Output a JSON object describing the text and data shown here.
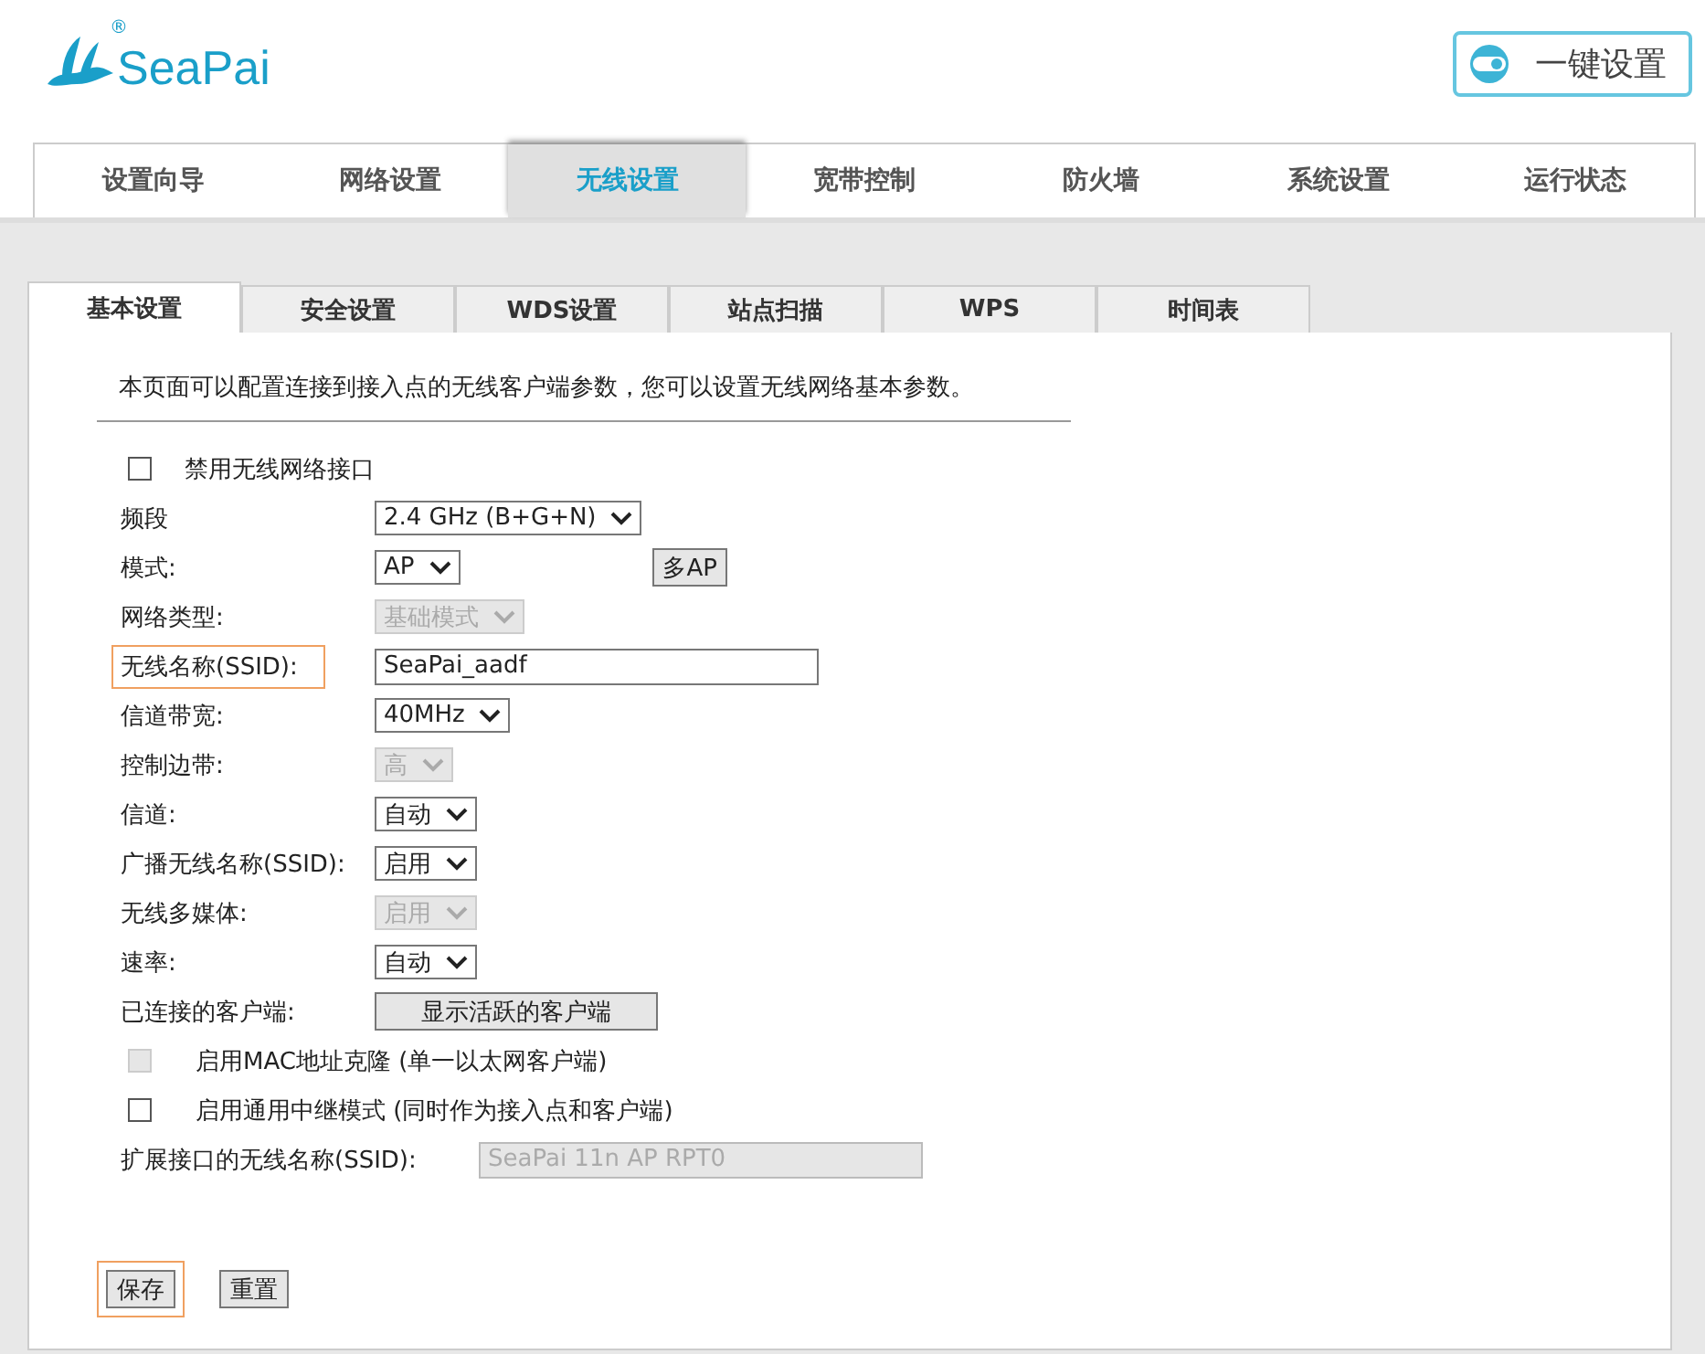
{
  "logo": {
    "name": "SeaPai",
    "mark": "®"
  },
  "quick_setup_button": {
    "label": "一键设置"
  },
  "nav_tabs": [
    {
      "label": "设置向导",
      "selected": false
    },
    {
      "label": "网络设置",
      "selected": false
    },
    {
      "label": "无线设置",
      "selected": true
    },
    {
      "label": "宽带控制",
      "selected": false
    },
    {
      "label": "防火墙",
      "selected": false
    },
    {
      "label": "系统设置",
      "selected": false
    },
    {
      "label": "运行状态",
      "selected": false
    }
  ],
  "sub_tabs": [
    {
      "label": "基本设置",
      "selected": true
    },
    {
      "label": "安全设置",
      "selected": false
    },
    {
      "label": "WDS设置",
      "selected": false
    },
    {
      "label": "站点扫描",
      "selected": false
    },
    {
      "label": "WPS",
      "selected": false
    },
    {
      "label": "时间表",
      "selected": false
    }
  ],
  "description": "本页面可以配置连接到接入点的无线客户端参数，您可以设置无线网络基本参数。",
  "form": [
    {
      "kind": "checkbox",
      "label": "禁用无线网络接口",
      "checked": false,
      "disabled": false
    },
    {
      "kind": "select",
      "label": "频段",
      "value": "2.4 GHz (B+G+N)",
      "disabled": false
    },
    {
      "kind": "select",
      "label": "模式:",
      "value": "AP",
      "disabled": false,
      "extra_button": "多AP"
    },
    {
      "kind": "select",
      "label": "网络类型:",
      "value": "基础模式",
      "disabled": true
    },
    {
      "kind": "text",
      "label": "无线名称(SSID):",
      "value": "SeaPai_aadf",
      "disabled": false,
      "highlighted": true
    },
    {
      "kind": "select",
      "label": "信道带宽:",
      "value": "40MHz",
      "disabled": false
    },
    {
      "kind": "select",
      "label": "控制边带:",
      "value": "高",
      "disabled": true
    },
    {
      "kind": "select",
      "label": "信道:",
      "value": "自动",
      "disabled": false
    },
    {
      "kind": "select",
      "label": "广播无线名称(SSID):",
      "value": "启用",
      "disabled": false
    },
    {
      "kind": "select",
      "label": "无线多媒体:",
      "value": "启用",
      "disabled": true
    },
    {
      "kind": "select",
      "label": "速率:",
      "value": "自动",
      "disabled": false
    },
    {
      "kind": "button",
      "label": "已连接的客户端:",
      "value": "显示活跃的客户端"
    },
    {
      "kind": "checkbox",
      "label": "启用MAC地址克隆 (单一以太网客户端)",
      "checked": false,
      "disabled": true
    },
    {
      "kind": "checkbox",
      "label": "启用通用中继模式 (同时作为接入点和客户端)",
      "checked": false,
      "disabled": false
    },
    {
      "kind": "text",
      "label": "扩展接口的无线名称(SSID):",
      "value": "SeaPai 11n AP RPT0",
      "disabled": true,
      "highlighted": false
    }
  ],
  "actions": [
    {
      "label": "保存",
      "highlighted": true
    },
    {
      "label": "重置",
      "highlighted": false
    }
  ]
}
